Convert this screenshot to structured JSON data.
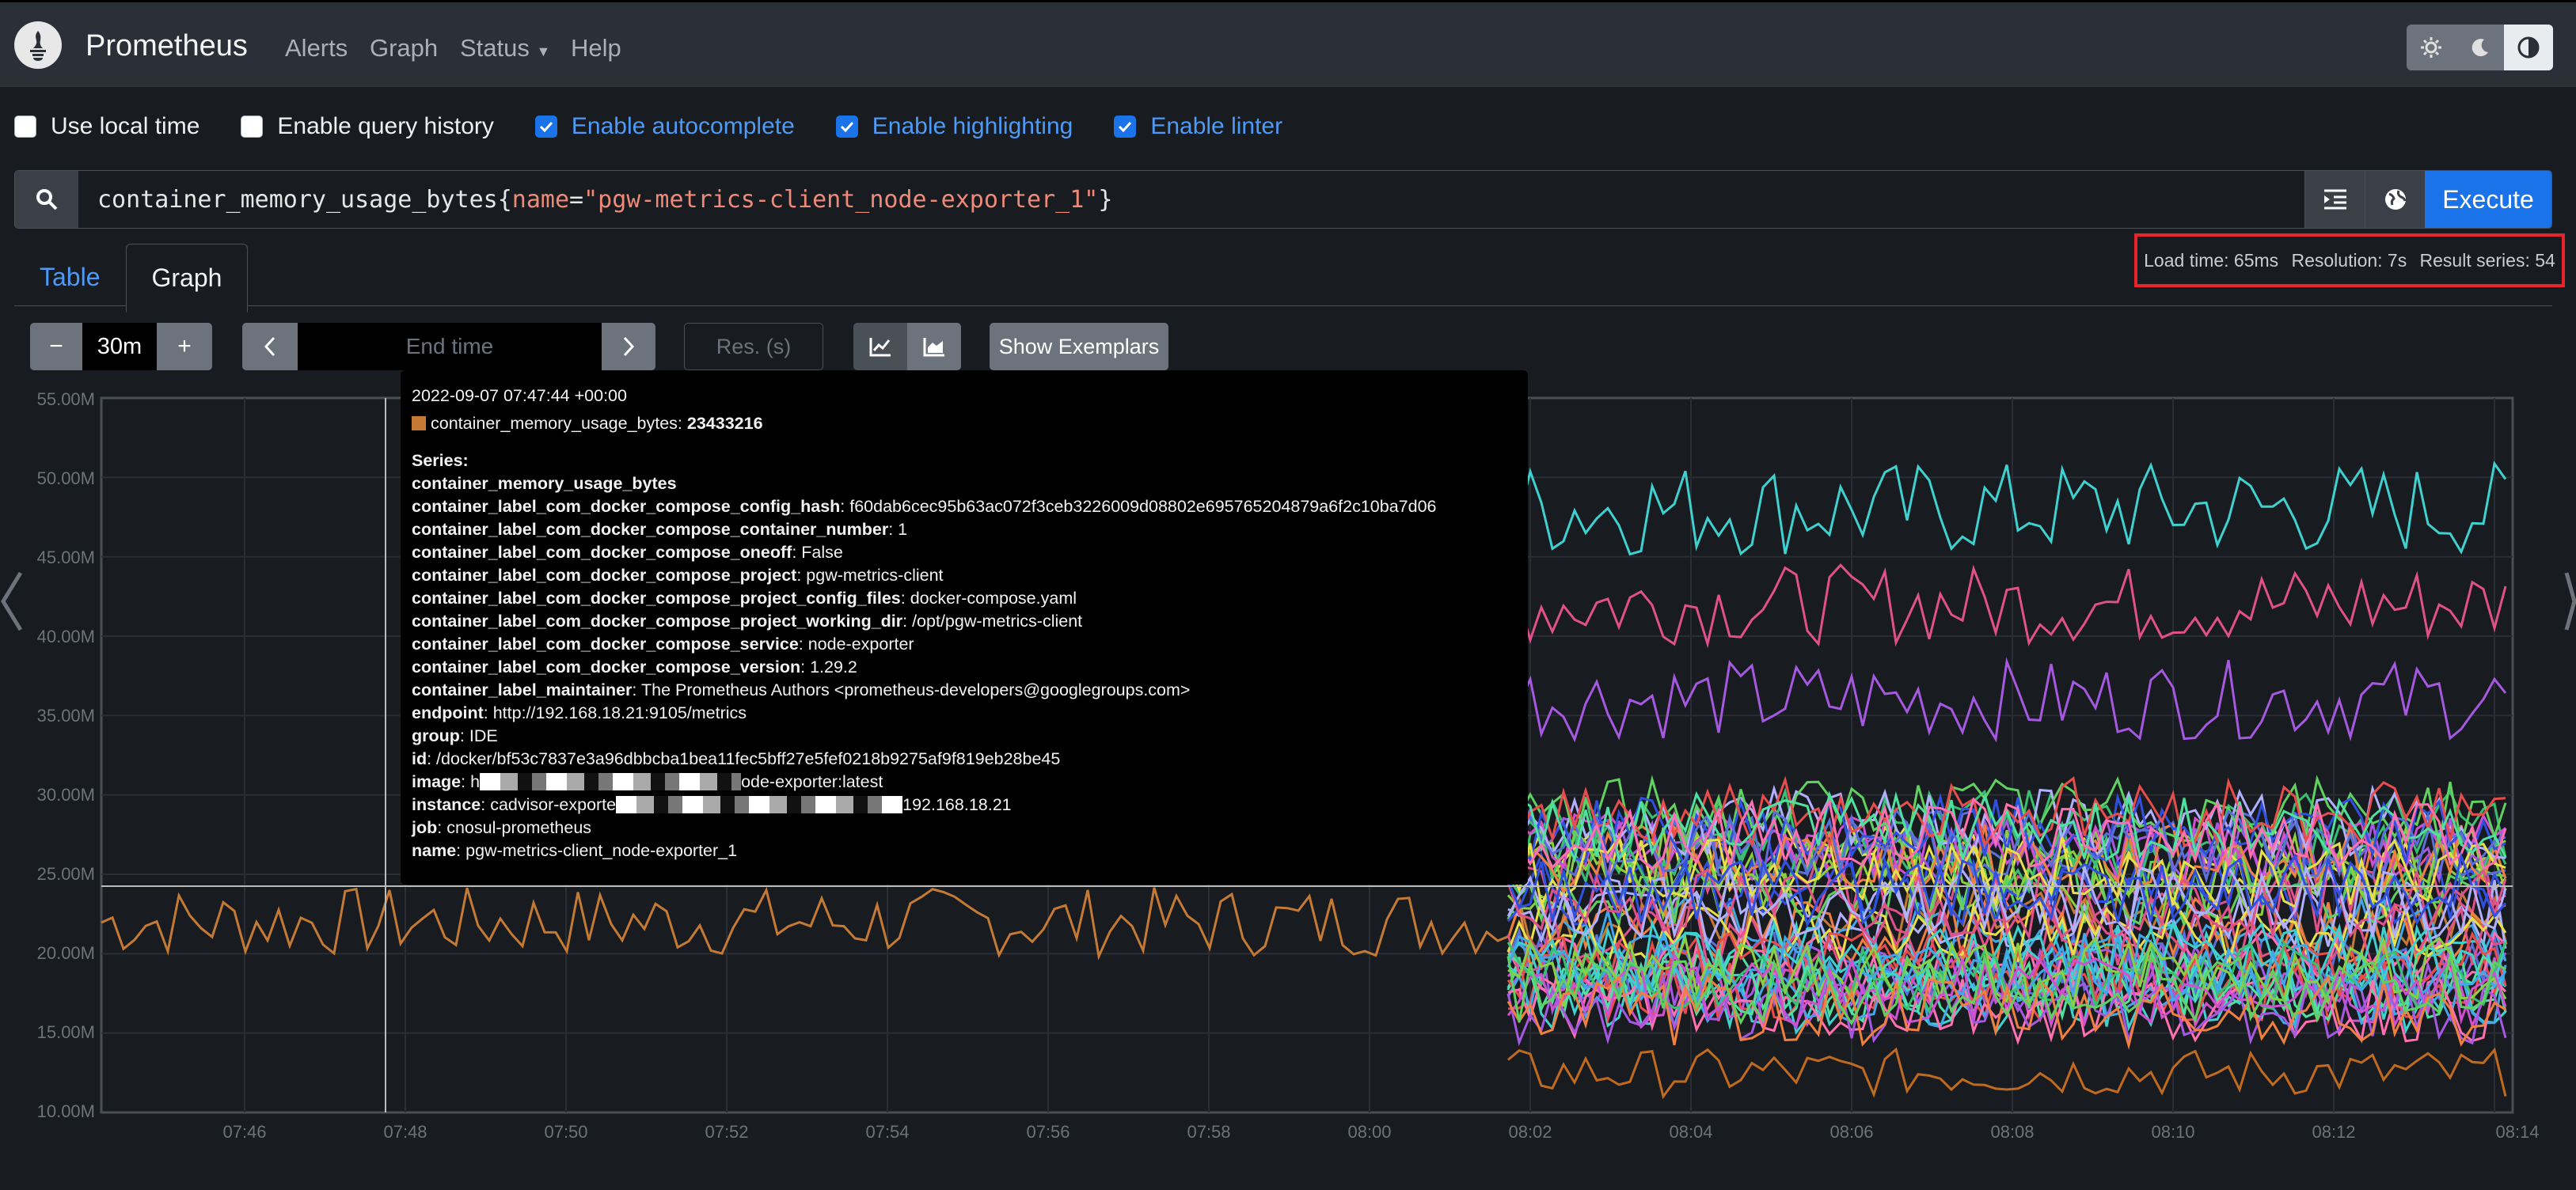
{
  "navbar": {
    "brand": "Prometheus",
    "links": [
      "Alerts",
      "Graph",
      "Status",
      "Help"
    ]
  },
  "options": [
    {
      "label": "Use local time",
      "checked": false
    },
    {
      "label": "Enable query history",
      "checked": false
    },
    {
      "label": "Enable autocomplete",
      "checked": true
    },
    {
      "label": "Enable highlighting",
      "checked": true
    },
    {
      "label": "Enable linter",
      "checked": true
    }
  ],
  "query": {
    "metric": "container_memory_usage_bytes",
    "open_brace": "{",
    "label_name": "name",
    "equals": "=",
    "label_value": "\"pgw-metrics-client_node-exporter_1\"",
    "close_brace": "}",
    "execute_label": "Execute"
  },
  "tabs": [
    "Table",
    "Graph"
  ],
  "stats": {
    "load_time": "Load time: 65ms",
    "resolution": "Resolution: 7s",
    "result_series": "Result series: 54"
  },
  "controls": {
    "minus": "−",
    "range": "30m",
    "plus": "+",
    "end_time_placeholder": "End time",
    "res_placeholder": "Res. (s)",
    "show_exemplars": "Show Exemplars"
  },
  "chart_data": {
    "type": "line",
    "ylim": [
      10,
      55
    ],
    "y_ticks": [
      "55.00M",
      "50.00M",
      "45.00M",
      "40.00M",
      "35.00M",
      "30.00M",
      "25.00M",
      "20.00M",
      "15.00M",
      "10.00M"
    ],
    "x_ticks": [
      "07:46",
      "07:48",
      "07:50",
      "07:52",
      "07:54",
      "07:56",
      "07:58",
      "08:00",
      "08:02",
      "08:04",
      "08:06",
      "08:08",
      "08:10",
      "08:12",
      "08:14"
    ],
    "series_count": 54,
    "highlighted_series": {
      "name": "pgw-metrics-client_node-exporter_1",
      "color": "#c47a35",
      "typical_value_m": 22
    }
  },
  "tooltip": {
    "timestamp": "2022-09-07 07:47:44 +00:00",
    "metric_label": "container_memory_usage_bytes:",
    "metric_value": "23433216",
    "series_heading": "Series:",
    "series_name": "container_memory_usage_bytes",
    "labels": [
      {
        "k": "container_label_com_docker_compose_config_hash",
        "v": "f60dab6cec95b63ac072f3ceb3226009d08802e695765204879a6f2c10ba7d06"
      },
      {
        "k": "container_label_com_docker_compose_container_number",
        "v": "1"
      },
      {
        "k": "container_label_com_docker_compose_oneoff",
        "v": "False"
      },
      {
        "k": "container_label_com_docker_compose_project",
        "v": "pgw-metrics-client"
      },
      {
        "k": "container_label_com_docker_compose_project_config_files",
        "v": "docker-compose.yaml"
      },
      {
        "k": "container_label_com_docker_compose_project_working_dir",
        "v": "/opt/pgw-metrics-client"
      },
      {
        "k": "container_label_com_docker_compose_service",
        "v": "node-exporter"
      },
      {
        "k": "container_label_com_docker_compose_version",
        "v": "1.29.2"
      },
      {
        "k": "container_label_maintainer",
        "v": "The Prometheus Authors <prometheus-developers@googlegroups.com>"
      },
      {
        "k": "endpoint",
        "v": "http://192.168.18.21:9105/metrics"
      },
      {
        "k": "group",
        "v": "IDE"
      },
      {
        "k": "id",
        "v": "/docker/bf53c7837e3a96dbbcba1bea11fec5bff27e5fef0218b9275af9f819eb28be45"
      }
    ],
    "image_prefix": "h",
    "image_suffix": "ode-exporter:latest",
    "instance_prefix": "cadvisor-exporte",
    "instance_suffix": "192.168.18.21",
    "job": "cnosul-prometheus",
    "name": "pgw-metrics-client_node-exporter_1"
  }
}
